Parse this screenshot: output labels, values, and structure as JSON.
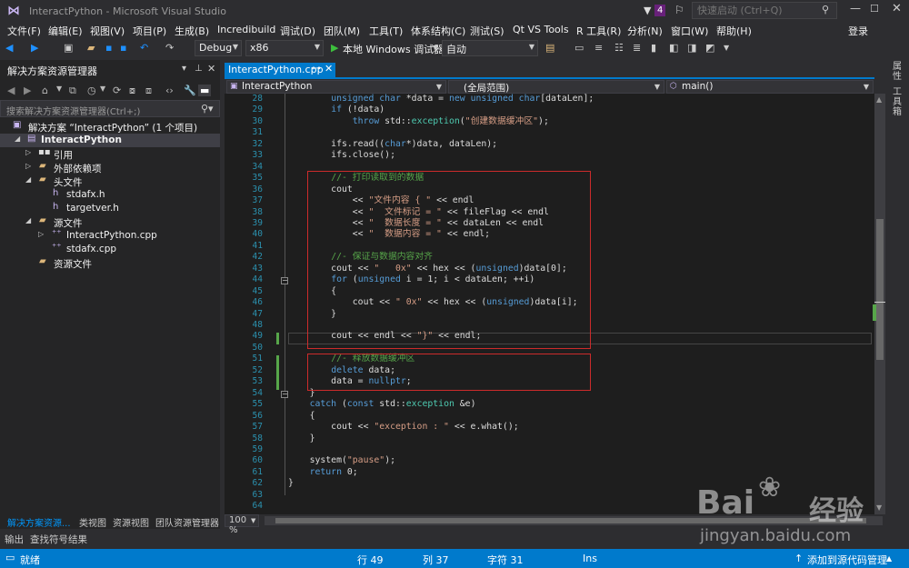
{
  "window": {
    "title": "InteractPython - Microsoft Visual Studio",
    "notification_count": "4",
    "quick_launch_placeholder": "快速启动 (Ctrl+Q)",
    "login": "登录"
  },
  "menu": [
    "文件(F)",
    "编辑(E)",
    "视图(V)",
    "项目(P)",
    "生成(B)",
    "Incredibuild",
    "调试(D)",
    "团队(M)",
    "工具(T)",
    "体系结构(C)",
    "测试(S)",
    "Qt VS Tools",
    "R 工具(R)",
    "分析(N)",
    "窗口(W)",
    "帮助(H)"
  ],
  "toolbar": {
    "config": "Debug",
    "platform": "x86",
    "run_label": "本地 Windows 调试器",
    "auto": "自动"
  },
  "solution_explorer": {
    "title": "解决方案资源管理器",
    "search_placeholder": "搜索解决方案资源管理器(Ctrl+;)",
    "tree": [
      {
        "label": "解决方案 “InteractPython” (1 个项目)",
        "icon": "solution-icon"
      },
      {
        "label": "InteractPython",
        "icon": "project-icon"
      },
      {
        "label": "引用",
        "icon": "references-icon"
      },
      {
        "label": "外部依赖项",
        "icon": "external-deps-icon"
      },
      {
        "label": "头文件",
        "icon": "folder-icon"
      },
      {
        "label": "stdafx.h",
        "icon": "header-file-icon"
      },
      {
        "label": "targetver.h",
        "icon": "header-file-icon"
      },
      {
        "label": "源文件",
        "icon": "folder-icon"
      },
      {
        "label": "InteractPython.cpp",
        "icon": "cpp-file-icon"
      },
      {
        "label": "stdafx.cpp",
        "icon": "cpp-file-icon"
      },
      {
        "label": "资源文件",
        "icon": "folder-icon"
      }
    ],
    "tabs": [
      "解决方案资源...",
      "类视图",
      "资源视图",
      "团队资源管理器"
    ]
  },
  "editor": {
    "tab_label": "InteractPython.cpp",
    "nav_project": "InteractPython",
    "nav_scope": "(全局范围)",
    "nav_member": "main()",
    "zoom": "100 %",
    "line_numbers": [
      "28",
      "29",
      "30",
      "31",
      "32",
      "33",
      "34",
      "35",
      "36",
      "37",
      "38",
      "39",
      "40",
      "41",
      "42",
      "43",
      "44",
      "45",
      "46",
      "47",
      "48",
      "49",
      "50",
      "51",
      "52",
      "53",
      "54",
      "55",
      "56",
      "57",
      "58",
      "59",
      "60",
      "61",
      "62",
      "63",
      "64"
    ]
  },
  "right_sidebar": [
    "属性",
    "工具箱"
  ],
  "bottom_tabs": [
    "输出",
    "查找符号结果"
  ],
  "status": {
    "ready": "就绪",
    "line": "行 49",
    "col": "列 37",
    "char": "字符 31",
    "mode": "Ins",
    "source_control": "添加到源代码管理"
  },
  "watermark": {
    "brand_left": "Bai",
    "brand_right": "经验",
    "url": "jingyan.baidu.com"
  }
}
